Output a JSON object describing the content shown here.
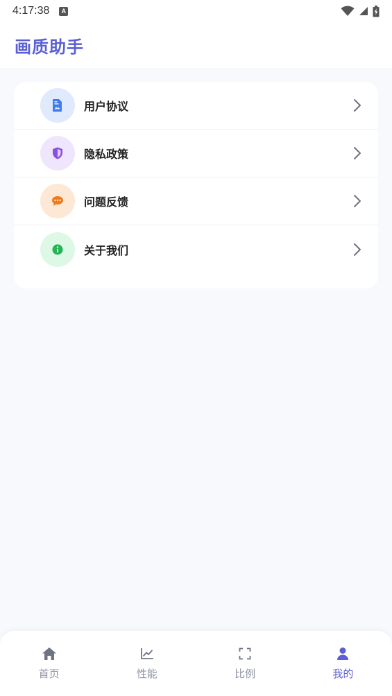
{
  "status_bar": {
    "time": "4:17:38",
    "notification_icon_letter": "A",
    "icons": [
      "wifi-icon",
      "signal-icon",
      "battery-charging-icon"
    ]
  },
  "header": {
    "title": "画质助手",
    "title_color": "#5b5fd6"
  },
  "menu": {
    "items": [
      {
        "label": "用户协议",
        "icon": "document-icon",
        "icon_bg": "#dfeafd",
        "icon_color": "#3f7cf0"
      },
      {
        "label": "隐私政策",
        "icon": "shield-icon",
        "icon_bg": "#efe6fd",
        "icon_color": "#8a4fe0"
      },
      {
        "label": "问题反馈",
        "icon": "chat-bubble-icon",
        "icon_bg": "#fde8d6",
        "icon_color": "#f07a1e"
      },
      {
        "label": "关于我们",
        "icon": "info-icon",
        "icon_bg": "#def8e6",
        "icon_color": "#22b455"
      }
    ]
  },
  "bottom_nav": {
    "items": [
      {
        "label": "首页",
        "icon": "home-icon",
        "active": false
      },
      {
        "label": "性能",
        "icon": "chart-line-icon",
        "active": false
      },
      {
        "label": "比例",
        "icon": "fullscreen-icon",
        "active": false
      },
      {
        "label": "我的",
        "icon": "user-icon",
        "active": true
      }
    ],
    "active_color": "#5b5fd6",
    "inactive_color": "#8e93a3"
  }
}
